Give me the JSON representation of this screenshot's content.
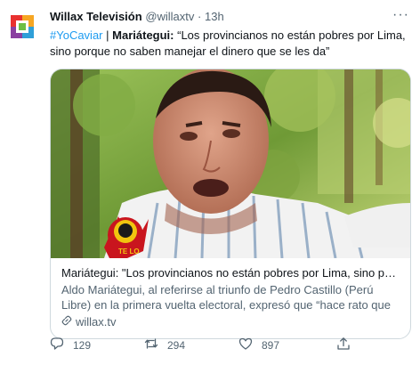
{
  "tweet": {
    "author_name": "Willax Televisión",
    "handle": "@willaxtv",
    "separator": "·",
    "time": "13h",
    "more": "···",
    "hashtag": "#YoCaviar",
    "pipe": "|",
    "subject": "Mariátegui:",
    "quote": "“Los provincianos no están pobres por Lima, sino porque no saben manejar el dinero que se les da”"
  },
  "card": {
    "title": "Mariátegui: \"Los provincianos no están pobres por Lima, sino porque n...",
    "description": "Aldo Mariátegui, al referirse al triunfo de Pedro Castillo (Perú Libre) en la primera vuelta electoral, expresó que “hace rato que los provincianos ...",
    "domain": "willax.tv",
    "badge_text": "TE LO"
  },
  "actions": {
    "replies": "129",
    "retweets": "294",
    "likes": "897"
  },
  "colors": {
    "accent": "#1d9bf0",
    "muted": "#536471",
    "border": "#cfd9de"
  },
  "icons": [
    "willax-logo-icon",
    "more-icon",
    "link-icon",
    "reply-icon",
    "retweet-icon",
    "like-icon",
    "share-icon"
  ]
}
